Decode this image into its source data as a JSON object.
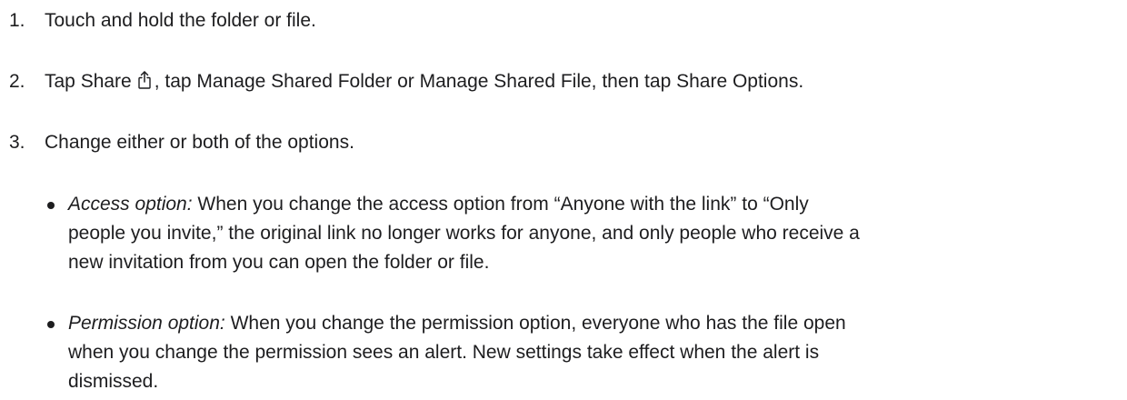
{
  "steps": [
    {
      "number": "1.",
      "text": "Touch and hold the folder or file."
    },
    {
      "number": "2.",
      "text_before_icon": "Tap Share",
      "icon": "share-icon",
      "text_after_icon": ", tap Manage Shared Folder or Manage Shared File, then tap Share Options."
    },
    {
      "number": "3.",
      "text": "Change either or both of the options."
    }
  ],
  "options": {
    "access": {
      "label": "Access option:",
      "lines": [
        " When you change the access option from “Anyone with the link” to “Only",
        "people you invite,” the original link no longer works for anyone, and only people who receive a",
        "new invitation from you can open the folder or file."
      ]
    },
    "permission": {
      "label": "Permission option:",
      "lines": [
        " When you change the permission option, everyone who has the file open",
        "when you change the permission sees an alert. New settings take effect when the alert is",
        "dismissed."
      ]
    }
  }
}
